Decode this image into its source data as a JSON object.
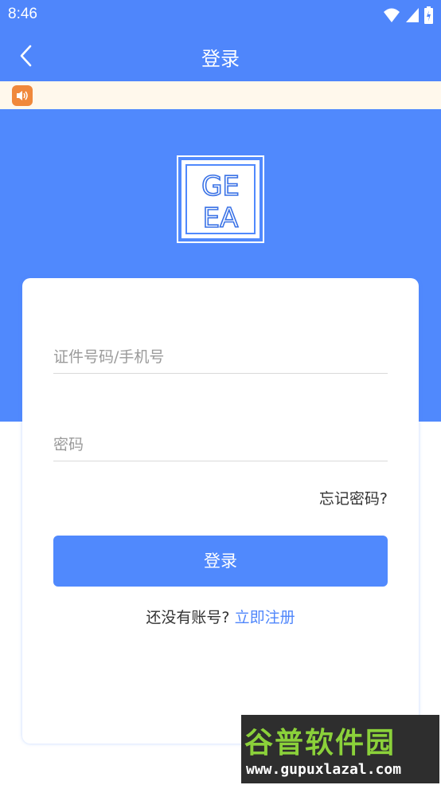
{
  "status": {
    "time": "8:46"
  },
  "appbar": {
    "title": "登录"
  },
  "logo": {
    "line1": "GE",
    "line2": "EA"
  },
  "form": {
    "id_placeholder": "证件号码/手机号",
    "password_placeholder": "密码",
    "forgot_label": "忘记密码?",
    "login_label": "登录",
    "no_account_text": "还没有账号?",
    "register_label": "立即注册"
  },
  "watermark": {
    "top": "谷普软件园",
    "bottom": "www.gupuxlazal.com"
  },
  "colors": {
    "primary": "#5089fd",
    "notice_bg": "#fff8ec",
    "notice_icon": "#f0883b"
  },
  "icons": [
    "wifi-icon",
    "cell-signal-icon",
    "battery-icon",
    "back-arrow-icon",
    "speaker-icon"
  ]
}
